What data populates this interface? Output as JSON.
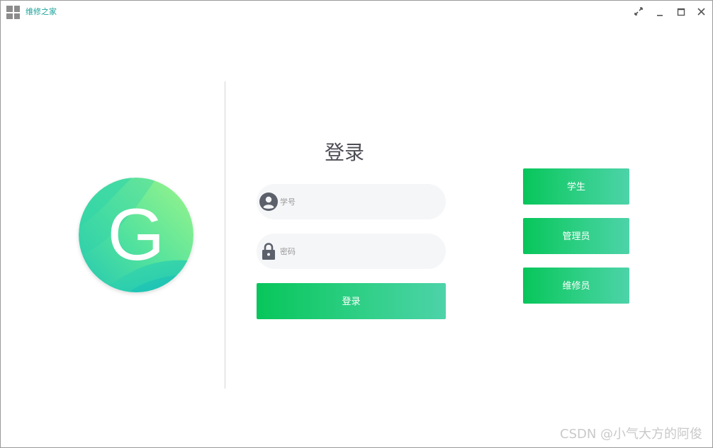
{
  "window": {
    "title": "维修之家",
    "controls": [
      "restore-icon",
      "minimize-icon",
      "maximize-icon",
      "close-icon"
    ]
  },
  "logo": {
    "letter": "G",
    "colors": [
      "#8af29a",
      "#3fdcae",
      "#1ec3b8"
    ]
  },
  "login": {
    "title": "登录",
    "username_placeholder": "学号",
    "password_placeholder": "密码",
    "submit_label": "登录"
  },
  "roles": [
    {
      "label": "学生"
    },
    {
      "label": "管理员"
    },
    {
      "label": "维修员"
    }
  ],
  "accent": {
    "button_gradient": [
      "#07c65a",
      "#4dd3a9"
    ],
    "title_color": "#1aa39a"
  },
  "watermark": "CSDN @小气大方的阿俊"
}
